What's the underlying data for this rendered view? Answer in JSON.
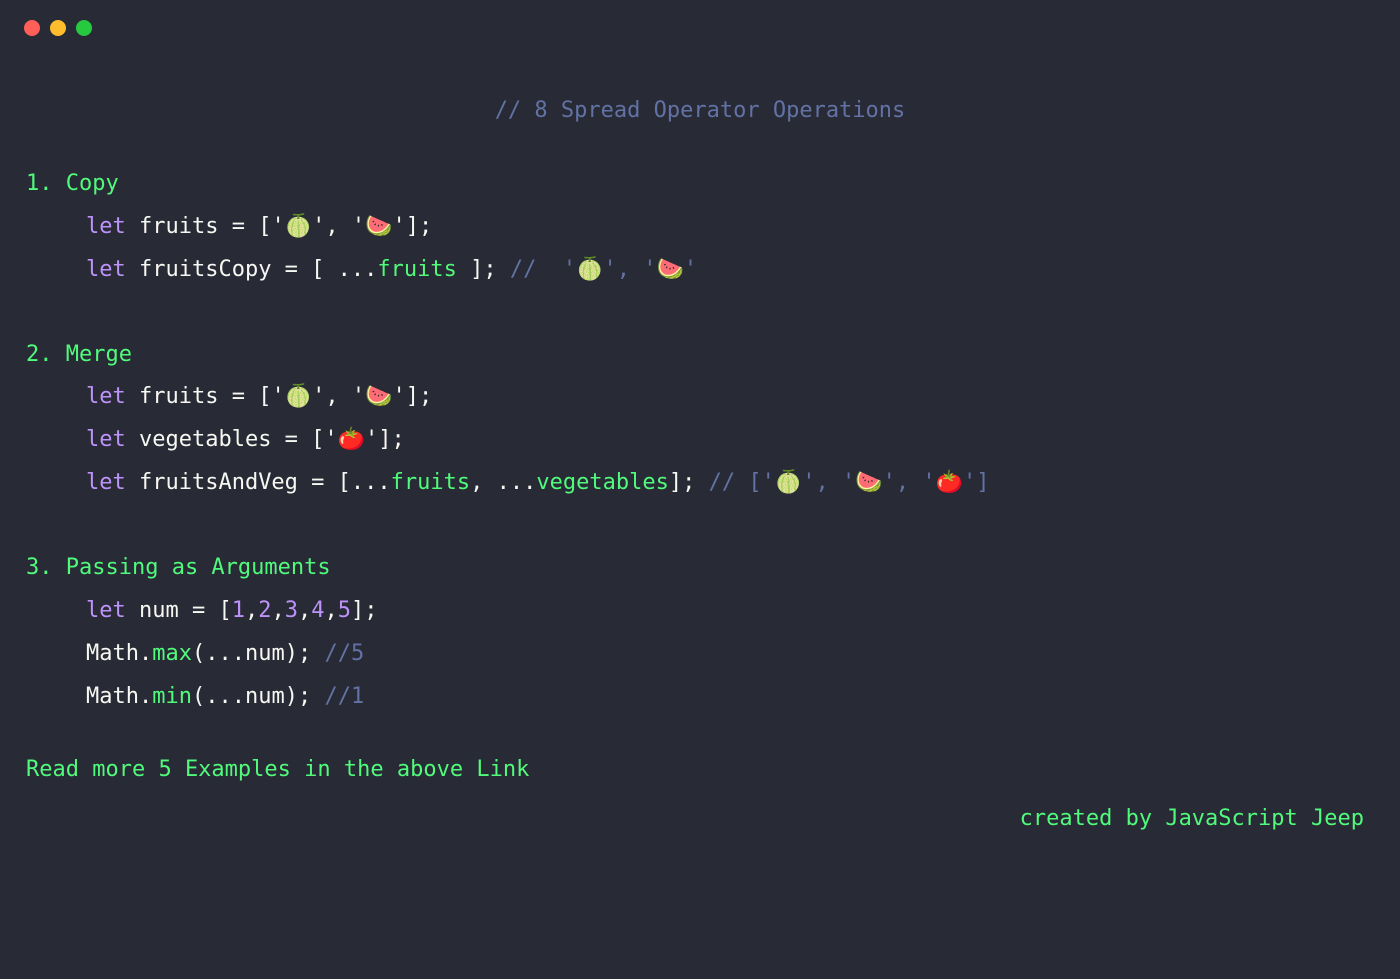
{
  "title_comment": "// 8 Spread Operator Operations",
  "sections": {
    "s1": {
      "heading": "1. Copy",
      "l1_let": "let ",
      "l1_var": "fruits",
      "l1_rest": " = ['🍈', '🍉'];",
      "l2_let": "let ",
      "l2_var": "fruitsCopy",
      "l2_eq": " = [ ",
      "l2_spread": "...",
      "l2_ident": "fruits",
      "l2_close": " ]; ",
      "l2_comment": "//  '🍈', '🍉'"
    },
    "s2": {
      "heading": "2. Merge",
      "l1_let": "let ",
      "l1_var": "fruits",
      "l1_rest": " = ['🍈', '🍉'];",
      "l2_let": "let ",
      "l2_var": "vegetables",
      "l2_rest": " = ['🍅'];",
      "l3_let": "let ",
      "l3_var": "fruitsAndVeg",
      "l3_eq": " = [",
      "l3_sp1": "...",
      "l3_id1": "fruits",
      "l3_comma": ", ",
      "l3_sp2": "...",
      "l3_id2": "vegetables",
      "l3_close": "]; ",
      "l3_comment": "// ['🍈', '🍉', '🍅']"
    },
    "s3": {
      "heading": "3. Passing as Arguments",
      "l1_let": "let ",
      "l1_var": "num",
      "l1_eq": " = [",
      "l1_n1": "1",
      "l1_c1": ",",
      "l1_n2": "2",
      "l1_c2": ",",
      "l1_n3": "3",
      "l1_c3": ",",
      "l1_n4": "4",
      "l1_c4": ",",
      "l1_n5": "5",
      "l1_close": "];",
      "l2_obj": "Math",
      "l2_dot": ".",
      "l2_fn": "max",
      "l2_open": "(",
      "l2_sp": "...",
      "l2_arg": "num",
      "l2_close": "); ",
      "l2_comment": "//5",
      "l3_obj": "Math",
      "l3_dot": ".",
      "l3_fn": "min",
      "l3_open": "(",
      "l3_sp": "...",
      "l3_arg": "num",
      "l3_close": "); ",
      "l3_comment": "//1"
    }
  },
  "footer_left": "Read more 5 Examples in the above Link",
  "footer_right": "created by JavaScript Jeep"
}
